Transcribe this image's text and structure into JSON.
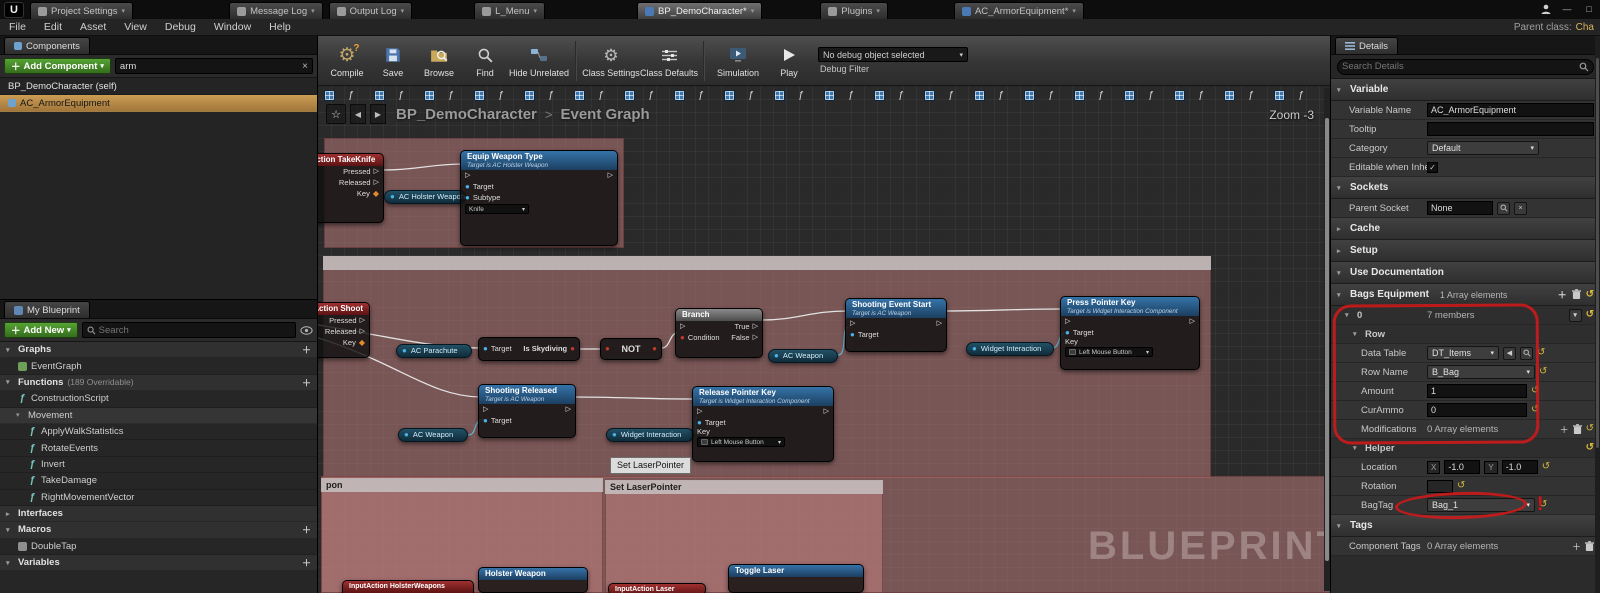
{
  "colors": {
    "accent_green": "#3f8b27",
    "selection_orange": "#c0914c",
    "event_node_red": "#8e1f1f",
    "function_node_blue": "#2e6b9e",
    "comment_pink": "#c78282",
    "annotation_red": "#d71919"
  },
  "icons": {
    "ue": "U",
    "fn": "ƒ",
    "caret_down": "▾",
    "caret_right": "▸",
    "plus": "＋",
    "close": "×",
    "star": "☆",
    "back": "◀",
    "forward": "▶",
    "gear": "⚙",
    "reset": "↺",
    "check": "✓",
    "exec": "▷",
    "dot": "●",
    "diamond": "◆",
    "question": "?",
    "minimize": "—",
    "maximize": "□",
    "chevron": ">",
    "alert": "!",
    "play": "▶"
  },
  "window": {
    "tabs": [
      "Project Settings",
      "Message Log",
      "Output Log",
      "L_Menu",
      "BP_DemoCharacter*",
      "Plugins",
      "AC_ArmorEquipment*"
    ],
    "parent_class_label": "Parent class:",
    "parent_class_value": "Cha"
  },
  "menu": {
    "items": [
      "File",
      "Edit",
      "Asset",
      "View",
      "Debug",
      "Window",
      "Help"
    ]
  },
  "components": {
    "tab": "Components",
    "add_component": "Add Component",
    "search_value": "arm",
    "self_item": "BP_DemoCharacter (self)",
    "selected_item": "AC_ArmorEquipment"
  },
  "my_blueprint": {
    "tab": "My Blueprint",
    "add_new": "Add New",
    "search_placeholder": "Search",
    "graphs_header": "Graphs",
    "eventgraph": "EventGraph",
    "functions_header": "Functions",
    "functions_badge": "(189 Overridable)",
    "construction_script": "ConstructionScript",
    "movement_category": "Movement",
    "fn_items": [
      "ApplyWalkStatistics",
      "RotateEvents",
      "Invert",
      "TakeDamage",
      "RightMovementVector"
    ],
    "interfaces_header": "Interfaces",
    "macros_header": "Macros",
    "double_tap": "DoubleTap",
    "variables_header": "Variables"
  },
  "toolbar": {
    "compile": "Compile",
    "save": "Save",
    "browse": "Browse",
    "find": "Find",
    "hide_unrelated": "Hide Unrelated",
    "class_settings": "Class Settings",
    "class_defaults": "Class Defaults",
    "simulation": "Simulation",
    "play": "Play",
    "debug_object": "No debug object selected",
    "debug_filter": "Debug Filter"
  },
  "graph": {
    "breadcrumb": {
      "root": "BP_DemoCharacter",
      "leaf": "Event Graph"
    },
    "zoom_label": "Zoom -3",
    "watermark": "BLUEPRINT",
    "tooltip": "Set LaserPointer",
    "comments": {
      "laser": "Set LaserPointer",
      "partial": "pon"
    },
    "pins": {
      "pressed": "Pressed",
      "released": "Released",
      "key": "Key",
      "target": "Target",
      "subtype": "Subtype",
      "condition": "Condition",
      "true_pin": "True",
      "false_pin": "False"
    },
    "nodes": {
      "take_knife": {
        "title": "InputAction TakeKnife"
      },
      "holster_pill": {
        "title": "AC Holster Weapon"
      },
      "equip": {
        "title": "Equip Weapon Type",
        "subtitle": "Target is AC Holster Weapon",
        "knife_value": "Knife"
      },
      "shoot": {
        "title": "InputAction Shoot"
      },
      "parachute_pill": {
        "title": "AC Parachute"
      },
      "skydiving": {
        "title": "Is Skydiving"
      },
      "not_node": {
        "title": "NOT"
      },
      "branch": {
        "title": "Branch"
      },
      "weapon_pill1": {
        "title": "AC Weapon"
      },
      "shooting_start": {
        "title": "Shooting Event Start",
        "subtitle": "Target is AC Weapon"
      },
      "widget_pill1": {
        "title": "Widget Interaction"
      },
      "press_pointer": {
        "title": "Press Pointer Key",
        "subtitle": "Target is Widget Interaction Component",
        "key_value": "Left Mouse Button"
      },
      "shooting_released": {
        "title": "Shooting Released",
        "subtitle": "Target is AC Weapon"
      },
      "weapon_pill2": {
        "title": "AC Weapon"
      },
      "widget_pill2": {
        "title": "Widget Interaction"
      },
      "release_pointer": {
        "title": "Release Pointer Key",
        "subtitle": "Target is Widget Interaction Component",
        "key_value": "Left Mouse Button"
      },
      "holster_event": {
        "title": "InputAction HolsterWeapons"
      },
      "holster_fn": {
        "title": "Holster Weapon"
      },
      "laser_event": {
        "title": "InputAction Laser"
      },
      "toggle_laser": {
        "title": "Toggle Laser"
      }
    }
  },
  "details": {
    "tab": "Details",
    "search_placeholder": "Search Details",
    "variable": {
      "header": "Variable",
      "variable_name_label": "Variable Name",
      "variable_name_value": "AC_ArmorEquipment",
      "tooltip_label": "Tooltip",
      "category_label": "Category",
      "category_value": "Default",
      "editable_label": "Editable when Inheri"
    },
    "sockets": {
      "header": "Sockets",
      "parent_socket_label": "Parent Socket",
      "parent_socket_value": "None"
    },
    "cache_header": "Cache",
    "setup_header": "Setup",
    "use_documentation_header": "Use Documentation",
    "bags": {
      "header": "Bags Equipment",
      "header_value": "1 Array elements",
      "element_index": "0",
      "element_value": "7 members",
      "row_header": "Row",
      "data_table_label": "Data Table",
      "data_table_value": "DT_Items",
      "row_name_label": "Row Name",
      "row_name_value": "B_Bag",
      "amount_label": "Amount",
      "amount_value": "1",
      "curammo_label": "CurAmmo",
      "curammo_value": "0",
      "modifications_label": "Modifications",
      "modifications_value": "0 Array elements",
      "helper_header": "Helper",
      "location_label": "Location",
      "x_label": "X",
      "x_value": "-1.0",
      "y_label": "Y",
      "y_value": "-1.0",
      "rotation_label": "Rotation",
      "bagtag_label": "BagTag",
      "bagtag_value": "Bag_1"
    },
    "tags": {
      "header": "Tags",
      "component_tags_label": "Component Tags",
      "component_tags_value": "0 Array elements"
    }
  }
}
